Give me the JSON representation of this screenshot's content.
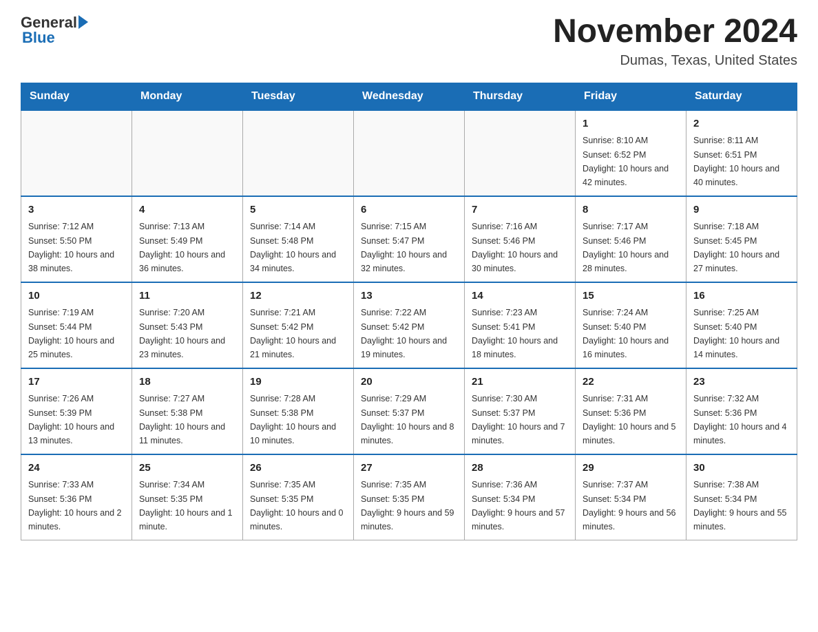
{
  "header": {
    "logo_general": "General",
    "logo_blue": "Blue",
    "month_title": "November 2024",
    "location": "Dumas, Texas, United States"
  },
  "days_of_week": [
    "Sunday",
    "Monday",
    "Tuesday",
    "Wednesday",
    "Thursday",
    "Friday",
    "Saturday"
  ],
  "weeks": [
    [
      {
        "day": "",
        "info": ""
      },
      {
        "day": "",
        "info": ""
      },
      {
        "day": "",
        "info": ""
      },
      {
        "day": "",
        "info": ""
      },
      {
        "day": "",
        "info": ""
      },
      {
        "day": "1",
        "info": "Sunrise: 8:10 AM\nSunset: 6:52 PM\nDaylight: 10 hours and 42 minutes."
      },
      {
        "day": "2",
        "info": "Sunrise: 8:11 AM\nSunset: 6:51 PM\nDaylight: 10 hours and 40 minutes."
      }
    ],
    [
      {
        "day": "3",
        "info": "Sunrise: 7:12 AM\nSunset: 5:50 PM\nDaylight: 10 hours and 38 minutes."
      },
      {
        "day": "4",
        "info": "Sunrise: 7:13 AM\nSunset: 5:49 PM\nDaylight: 10 hours and 36 minutes."
      },
      {
        "day": "5",
        "info": "Sunrise: 7:14 AM\nSunset: 5:48 PM\nDaylight: 10 hours and 34 minutes."
      },
      {
        "day": "6",
        "info": "Sunrise: 7:15 AM\nSunset: 5:47 PM\nDaylight: 10 hours and 32 minutes."
      },
      {
        "day": "7",
        "info": "Sunrise: 7:16 AM\nSunset: 5:46 PM\nDaylight: 10 hours and 30 minutes."
      },
      {
        "day": "8",
        "info": "Sunrise: 7:17 AM\nSunset: 5:46 PM\nDaylight: 10 hours and 28 minutes."
      },
      {
        "day": "9",
        "info": "Sunrise: 7:18 AM\nSunset: 5:45 PM\nDaylight: 10 hours and 27 minutes."
      }
    ],
    [
      {
        "day": "10",
        "info": "Sunrise: 7:19 AM\nSunset: 5:44 PM\nDaylight: 10 hours and 25 minutes."
      },
      {
        "day": "11",
        "info": "Sunrise: 7:20 AM\nSunset: 5:43 PM\nDaylight: 10 hours and 23 minutes."
      },
      {
        "day": "12",
        "info": "Sunrise: 7:21 AM\nSunset: 5:42 PM\nDaylight: 10 hours and 21 minutes."
      },
      {
        "day": "13",
        "info": "Sunrise: 7:22 AM\nSunset: 5:42 PM\nDaylight: 10 hours and 19 minutes."
      },
      {
        "day": "14",
        "info": "Sunrise: 7:23 AM\nSunset: 5:41 PM\nDaylight: 10 hours and 18 minutes."
      },
      {
        "day": "15",
        "info": "Sunrise: 7:24 AM\nSunset: 5:40 PM\nDaylight: 10 hours and 16 minutes."
      },
      {
        "day": "16",
        "info": "Sunrise: 7:25 AM\nSunset: 5:40 PM\nDaylight: 10 hours and 14 minutes."
      }
    ],
    [
      {
        "day": "17",
        "info": "Sunrise: 7:26 AM\nSunset: 5:39 PM\nDaylight: 10 hours and 13 minutes."
      },
      {
        "day": "18",
        "info": "Sunrise: 7:27 AM\nSunset: 5:38 PM\nDaylight: 10 hours and 11 minutes."
      },
      {
        "day": "19",
        "info": "Sunrise: 7:28 AM\nSunset: 5:38 PM\nDaylight: 10 hours and 10 minutes."
      },
      {
        "day": "20",
        "info": "Sunrise: 7:29 AM\nSunset: 5:37 PM\nDaylight: 10 hours and 8 minutes."
      },
      {
        "day": "21",
        "info": "Sunrise: 7:30 AM\nSunset: 5:37 PM\nDaylight: 10 hours and 7 minutes."
      },
      {
        "day": "22",
        "info": "Sunrise: 7:31 AM\nSunset: 5:36 PM\nDaylight: 10 hours and 5 minutes."
      },
      {
        "day": "23",
        "info": "Sunrise: 7:32 AM\nSunset: 5:36 PM\nDaylight: 10 hours and 4 minutes."
      }
    ],
    [
      {
        "day": "24",
        "info": "Sunrise: 7:33 AM\nSunset: 5:36 PM\nDaylight: 10 hours and 2 minutes."
      },
      {
        "day": "25",
        "info": "Sunrise: 7:34 AM\nSunset: 5:35 PM\nDaylight: 10 hours and 1 minute."
      },
      {
        "day": "26",
        "info": "Sunrise: 7:35 AM\nSunset: 5:35 PM\nDaylight: 10 hours and 0 minutes."
      },
      {
        "day": "27",
        "info": "Sunrise: 7:35 AM\nSunset: 5:35 PM\nDaylight: 9 hours and 59 minutes."
      },
      {
        "day": "28",
        "info": "Sunrise: 7:36 AM\nSunset: 5:34 PM\nDaylight: 9 hours and 57 minutes."
      },
      {
        "day": "29",
        "info": "Sunrise: 7:37 AM\nSunset: 5:34 PM\nDaylight: 9 hours and 56 minutes."
      },
      {
        "day": "30",
        "info": "Sunrise: 7:38 AM\nSunset: 5:34 PM\nDaylight: 9 hours and 55 minutes."
      }
    ]
  ]
}
